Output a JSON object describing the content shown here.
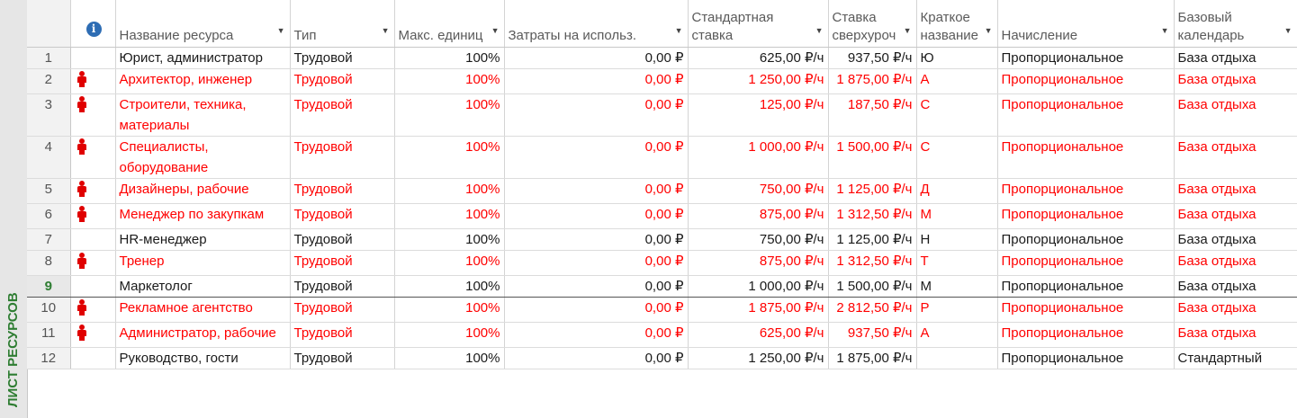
{
  "view_bar": {
    "label": "ЛИСТ РЕСУРСОВ"
  },
  "columns": {
    "indicators_icon": "i",
    "name": "Название ресурса",
    "type": "Тип",
    "max_units": "Макс. единиц",
    "cost_per_use": "Затраты на использ.",
    "std_rate": "Стандартная ставка",
    "ovt_rate": "Ставка сверхуроч",
    "initials": "Краткое название",
    "accrue": "Начисление",
    "calendar": "Базовый календарь"
  },
  "rows": [
    {
      "id": "1",
      "indicator": "",
      "name": "Юрист, администратор",
      "type": "Трудовой",
      "max_units": "100%",
      "cost_per_use": "0,00 ₽",
      "std_rate": "625,00 ₽/ч",
      "ovt_rate": "937,50 ₽/ч",
      "initials": "Ю",
      "accrue": "Пропорциональное",
      "calendar": "База отдыха"
    },
    {
      "id": "2",
      "indicator": "overallocated-person-icon",
      "name": "Архитектор, инженер",
      "type": "Трудовой",
      "max_units": "100%",
      "cost_per_use": "0,00 ₽",
      "std_rate": "1 250,00 ₽/ч",
      "ovt_rate": "1 875,00 ₽/ч",
      "initials": "А",
      "accrue": "Пропорциональное",
      "calendar": "База отдыха"
    },
    {
      "id": "3",
      "indicator": "overallocated-person-icon",
      "name": "Строители, техника, материалы",
      "type": "Трудовой",
      "max_units": "100%",
      "cost_per_use": "0,00 ₽",
      "std_rate": "125,00 ₽/ч",
      "ovt_rate": "187,50 ₽/ч",
      "initials": "С",
      "accrue": "Пропорциональное",
      "calendar": "База отдыха"
    },
    {
      "id": "4",
      "indicator": "overallocated-person-icon",
      "name": "Специалисты, оборудование",
      "type": "Трудовой",
      "max_units": "100%",
      "cost_per_use": "0,00 ₽",
      "std_rate": "1 000,00 ₽/ч",
      "ovt_rate": "1 500,00 ₽/ч",
      "initials": "С",
      "accrue": "Пропорциональное",
      "calendar": "База отдыха"
    },
    {
      "id": "5",
      "indicator": "overallocated-person-icon",
      "name": "Дизайнеры, рабочие",
      "type": "Трудовой",
      "max_units": "100%",
      "cost_per_use": "0,00 ₽",
      "std_rate": "750,00 ₽/ч",
      "ovt_rate": "1 125,00 ₽/ч",
      "initials": "Д",
      "accrue": "Пропорциональное",
      "calendar": "База отдыха"
    },
    {
      "id": "6",
      "indicator": "overallocated-person-icon",
      "name": "Менеджер по закупкам",
      "type": "Трудовой",
      "max_units": "100%",
      "cost_per_use": "0,00 ₽",
      "std_rate": "875,00 ₽/ч",
      "ovt_rate": "1 312,50 ₽/ч",
      "initials": "М",
      "accrue": "Пропорциональное",
      "calendar": "База отдыха"
    },
    {
      "id": "7",
      "indicator": "",
      "name": "HR-менеджер",
      "type": "Трудовой",
      "max_units": "100%",
      "cost_per_use": "0,00 ₽",
      "std_rate": "750,00 ₽/ч",
      "ovt_rate": "1 125,00 ₽/ч",
      "initials": "Н",
      "accrue": "Пропорциональное",
      "calendar": "База отдыха"
    },
    {
      "id": "8",
      "indicator": "overallocated-person-icon",
      "name": "Тренер",
      "type": "Трудовой",
      "max_units": "100%",
      "cost_per_use": "0,00 ₽",
      "std_rate": "875,00 ₽/ч",
      "ovt_rate": "1 312,50 ₽/ч",
      "initials": "Т",
      "accrue": "Пропорциональное",
      "calendar": "База отдыха"
    },
    {
      "id": "9",
      "indicator": "",
      "name": "Маркетолог",
      "type": "Трудовой",
      "max_units": "100%",
      "cost_per_use": "0,00 ₽",
      "std_rate": "1 000,00 ₽/ч",
      "ovt_rate": "1 500,00 ₽/ч",
      "initials": "М",
      "accrue": "Пропорциональное",
      "calendar": "База отдыха"
    },
    {
      "id": "10",
      "indicator": "overallocated-person-icon",
      "name": "Рекламное агентство",
      "type": "Трудовой",
      "max_units": "100%",
      "cost_per_use": "0,00 ₽",
      "std_rate": "1 875,00 ₽/ч",
      "ovt_rate": "2 812,50 ₽/ч",
      "initials": "Р",
      "accrue": "Пропорциональное",
      "calendar": "База отдыха"
    },
    {
      "id": "11",
      "indicator": "overallocated-person-icon",
      "name": "Администратор, рабочие",
      "type": "Трудовой",
      "max_units": "100%",
      "cost_per_use": "0,00 ₽",
      "std_rate": "625,00 ₽/ч",
      "ovt_rate": "937,50 ₽/ч",
      "initials": "А",
      "accrue": "Пропорциональное",
      "calendar": "База отдыха"
    },
    {
      "id": "12",
      "indicator": "",
      "name": "Руководство, гости",
      "type": "Трудовой",
      "max_units": "100%",
      "cost_per_use": "0,00 ₽",
      "std_rate": "1 250,00 ₽/ч",
      "ovt_rate": "1 875,00 ₽/ч",
      "initials": "",
      "accrue": "Пропорциональное",
      "calendar": "Стандартный"
    }
  ],
  "selected_row": "9",
  "colors": {
    "overallocated": "#ff0000",
    "view_bar_text": "#2e7d32",
    "info_icon": "#2e6db4"
  }
}
